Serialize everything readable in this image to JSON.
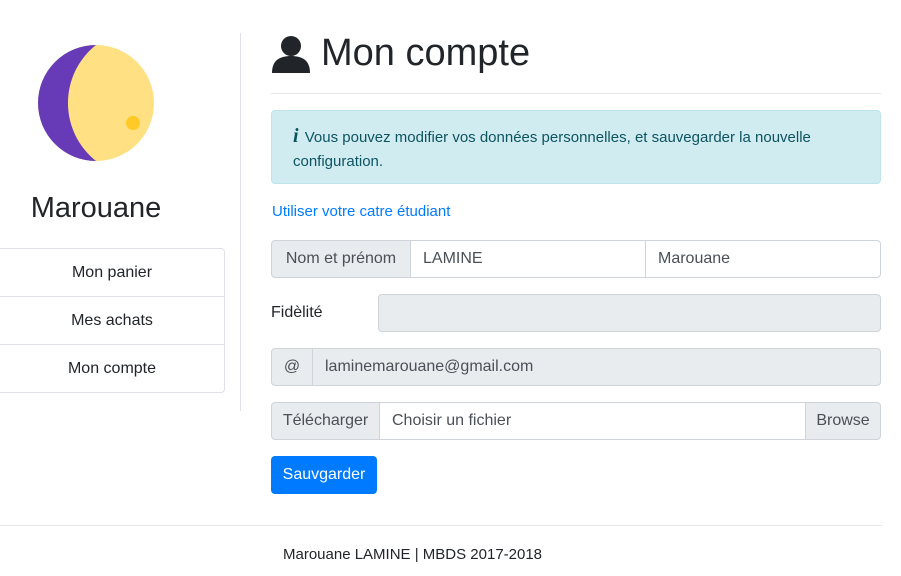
{
  "sidebar": {
    "username": "Marouane",
    "items": [
      {
        "label": "Mon panier"
      },
      {
        "label": "Mes achats"
      },
      {
        "label": "Mon compte"
      }
    ]
  },
  "header": {
    "title": "Mon compte"
  },
  "alert": {
    "text": "Vous pouvez modifier vos données personnelles, et sauvegarder la nouvelle configuration."
  },
  "student_card_link": "Utiliser votre catre étudiant",
  "form": {
    "name_label": "Nom et prénom",
    "last_name": "LAMINE",
    "first_name": "Marouane",
    "fidelity_label": "Fidèlité",
    "fidelity_value": "",
    "email_prefix": "@",
    "email": "laminemarouane@gmail.com",
    "upload_label": "Télécharger",
    "file_placeholder": "Choisir un fichier",
    "browse_label": "Browse",
    "save_label": "Sauvgarder"
  },
  "footer": {
    "text": "Marouane LAMINE | MBDS 2017-2018"
  },
  "colors": {
    "primary": "#007bff",
    "alert_bg": "#d1ecf1",
    "alert_text": "#0c5460",
    "avatar_purple": "#673ab7",
    "avatar_yellow": "#ffe082"
  },
  "icons": {
    "avatar": "moon-avatar-icon",
    "title": "user-icon",
    "alert": "info-icon"
  }
}
